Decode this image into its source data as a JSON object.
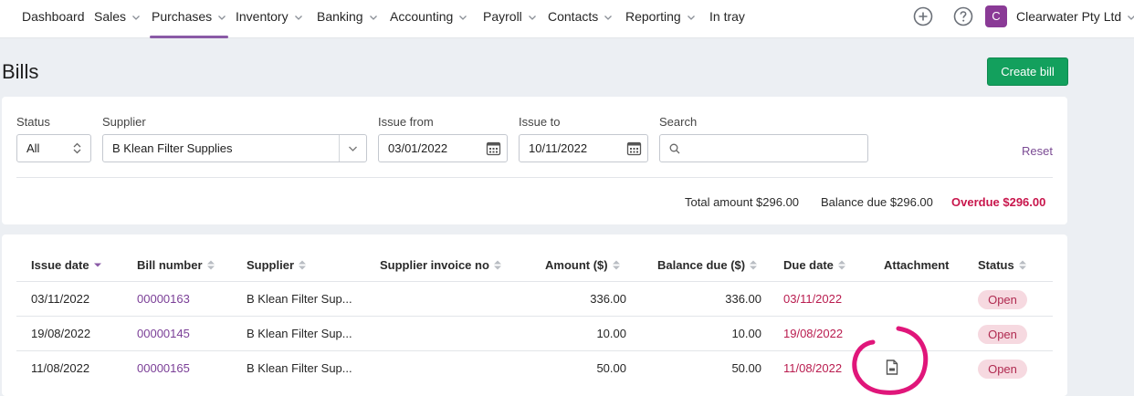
{
  "nav": {
    "items": [
      {
        "label": "Dashboard",
        "has_menu": false
      },
      {
        "label": "Sales",
        "has_menu": true
      },
      {
        "label": "Purchases",
        "has_menu": true,
        "active": true
      },
      {
        "label": "Inventory",
        "has_menu": true
      },
      {
        "label": "Banking",
        "has_menu": true
      },
      {
        "label": "Accounting",
        "has_menu": true
      },
      {
        "label": "Payroll",
        "has_menu": true
      },
      {
        "label": "Contacts",
        "has_menu": true
      },
      {
        "label": "Reporting",
        "has_menu": true
      },
      {
        "label": "In tray",
        "has_menu": false
      }
    ],
    "org_initial": "C",
    "org_name": "Clearwater Pty Ltd",
    "icons": [
      "add-icon",
      "help-icon"
    ]
  },
  "page": {
    "title": "Bills",
    "create_label": "Create bill"
  },
  "filters": {
    "status": {
      "label": "Status",
      "value": "All"
    },
    "supplier": {
      "label": "Supplier",
      "value": "B Klean Filter Supplies"
    },
    "issue_from": {
      "label": "Issue from",
      "value": "03/01/2022"
    },
    "issue_to": {
      "label": "Issue to",
      "value": "10/11/2022"
    },
    "search": {
      "label": "Search",
      "value": ""
    },
    "reset_label": "Reset"
  },
  "totals": {
    "total_amount": "Total amount $296.00",
    "balance_due": "Balance due $296.00",
    "overdue": "Overdue $296.00"
  },
  "table": {
    "headers": {
      "issue_date": "Issue date",
      "bill_number": "Bill number",
      "supplier": "Supplier",
      "supplier_invoice_no": "Supplier invoice no",
      "amount": "Amount ($)",
      "balance_due": "Balance due ($)",
      "due_date": "Due date",
      "attachment": "Attachment",
      "status": "Status"
    },
    "rows": [
      {
        "issue_date": "03/11/2022",
        "bill_number": "00000163",
        "supplier": "B Klean Filter Sup...",
        "supplier_invoice_no": "",
        "amount": "336.00",
        "balance_due": "336.00",
        "due_date": "03/11/2022",
        "attachment": false,
        "status": "Open"
      },
      {
        "issue_date": "19/08/2022",
        "bill_number": "00000145",
        "supplier": "B Klean Filter Sup...",
        "supplier_invoice_no": "",
        "amount": "10.00",
        "balance_due": "10.00",
        "due_date": "19/08/2022",
        "attachment": false,
        "status": "Open"
      },
      {
        "issue_date": "11/08/2022",
        "bill_number": "00000165",
        "supplier": "B Klean Filter Sup...",
        "supplier_invoice_no": "",
        "amount": "50.00",
        "balance_due": "50.00",
        "due_date": "11/08/2022",
        "attachment": true,
        "status": "Open"
      }
    ]
  },
  "colors": {
    "accent_purple": "#7b3f97",
    "nav_underline": "#8a5aa6",
    "create_button": "#13a05d",
    "overdue": "#c8164c",
    "open_badge_bg": "#f6d9e0",
    "annotation_circle": "#e0167a"
  }
}
